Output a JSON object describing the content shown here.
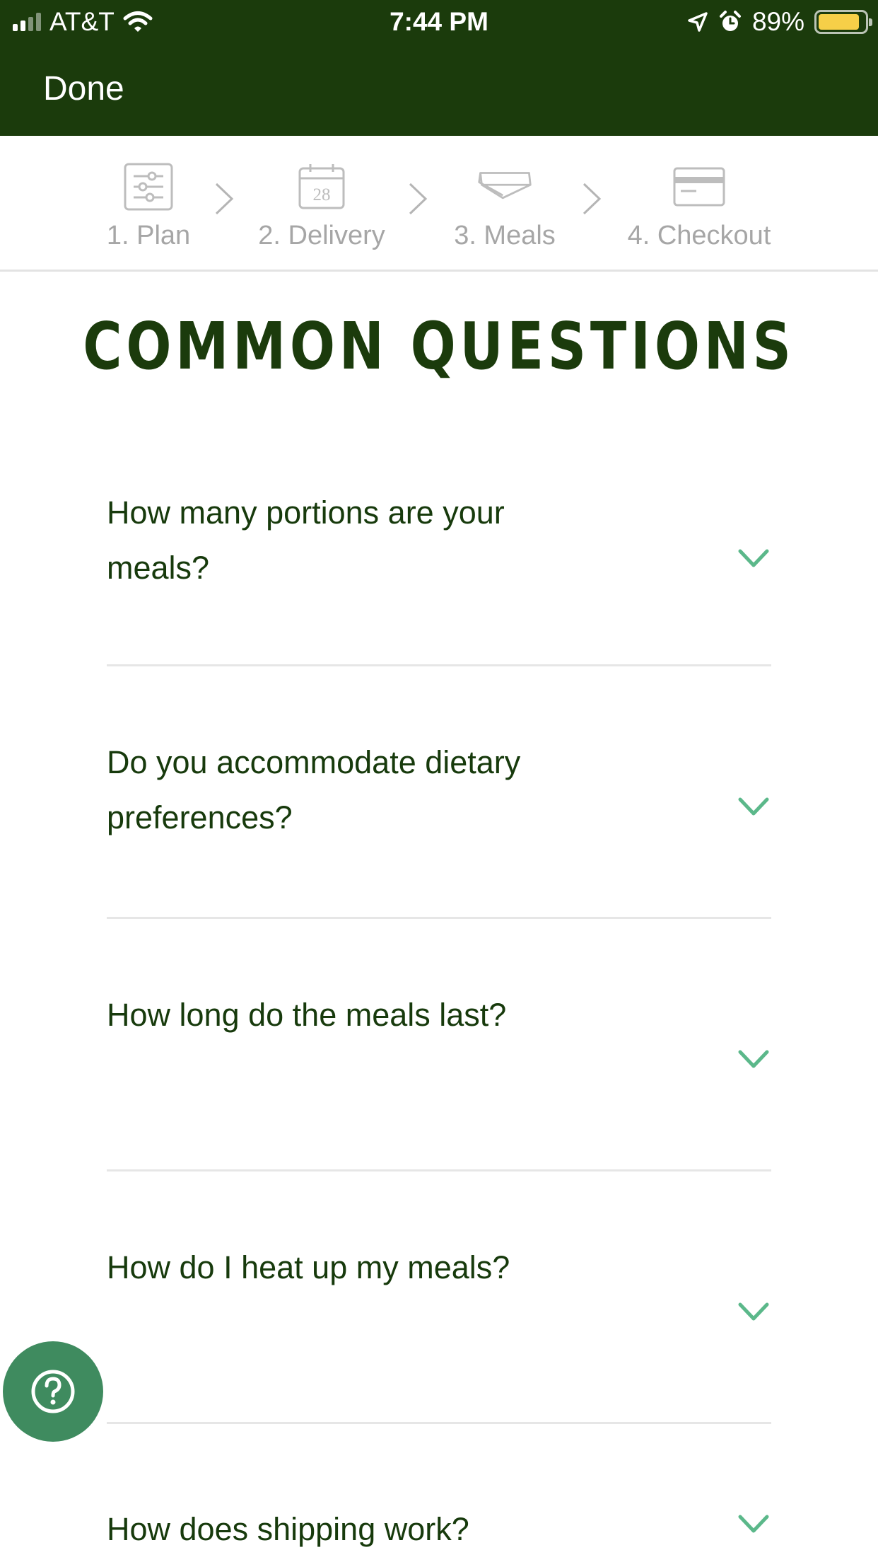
{
  "status_bar": {
    "carrier": "AT&T",
    "time": "7:44 PM",
    "battery_percent": "89%",
    "battery_level": 0.89,
    "icons": [
      "signal-icon",
      "wifi-icon",
      "location-icon",
      "alarm-icon",
      "battery-icon"
    ]
  },
  "nav": {
    "done_label": "Done"
  },
  "stepper": {
    "steps": [
      {
        "label": "1. Plan",
        "icon": "sliders-icon"
      },
      {
        "label": "2. Delivery",
        "icon": "calendar-icon",
        "icon_text": "28"
      },
      {
        "label": "3. Meals",
        "icon": "meal-tray-icon"
      },
      {
        "label": "4. Checkout",
        "icon": "credit-card-icon"
      }
    ],
    "separator_icon": "chevron-right-icon"
  },
  "main": {
    "title": "COMMON QUESTIONS",
    "faqs": [
      {
        "question": "How many portions are your meals?"
      },
      {
        "question": "Do you accommodate dietary preferences?"
      },
      {
        "question": "How long do the meals last?"
      },
      {
        "question": "How do I heat up my meals?"
      },
      {
        "question": "How does shipping work?"
      }
    ],
    "expand_icon": "chevron-down-icon"
  },
  "help_button": {
    "icon": "question-mark-icon"
  },
  "colors": {
    "header_bg": "#1b3b0c",
    "title": "#1b3b0c",
    "question_text": "#173a0c",
    "chevron_accent": "#5bb88a",
    "help_button": "#3f8b5f",
    "step_label": "#a6a6a6",
    "battery": "#f6cf48"
  }
}
